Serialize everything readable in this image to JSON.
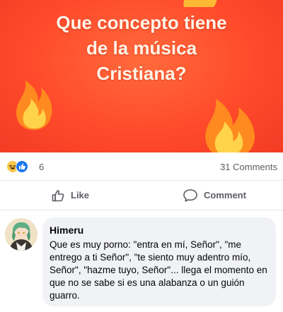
{
  "post": {
    "banner_lines": [
      "Que concepto tiene",
      "de la música",
      "Cristiana?"
    ],
    "background_color": "#ff4b2b",
    "text_color": "#fff4e8",
    "decoration_icons": [
      "fire-icon",
      "fire-icon",
      "fire-icon"
    ]
  },
  "reactions": {
    "icons": [
      "haha-icon",
      "like-icon"
    ],
    "count": "6",
    "comments_count": "31 Comments"
  },
  "actions": {
    "like_label": "Like",
    "comment_label": "Comment"
  },
  "comment": {
    "author": "Himeru",
    "text": "Que es muy porno: \"entra en mí, Señor\", \"me entrego a ti Señor\", \"te siento muy adentro mío, Señor\", \"hazme tuyo, Señor\"... llega el momento en que no se sabe si es una alabanza o un guión guarro."
  },
  "colors": {
    "like_blue": "#1877f2",
    "haha_yellow": "#f7c64a",
    "bubble_gray": "#f0f2f5",
    "secondary_text": "#5a5d63"
  }
}
